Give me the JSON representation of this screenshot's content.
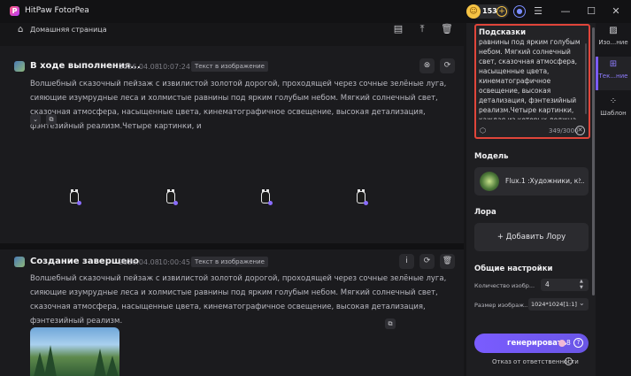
{
  "app": {
    "title": "HitPaw FotorPea",
    "logo_letter": "P",
    "credits": "153",
    "credits_plus": "+"
  },
  "window_controls": {
    "minimize": "—",
    "maximize": "☐",
    "close": "✕",
    "menu": "☰"
  },
  "nav": {
    "home_label": "Домашняя страница"
  },
  "cards": [
    {
      "title": "В ходе выполнения...",
      "date": "2026.04.08",
      "time": "10:07:24",
      "tag": "Текст в изображение",
      "text": "Волшебный сказочный пейзаж с извилистой золотой дорогой, проходящей через сочные зелёные луга, сияющие изумрудные леса и холмистые равнины под ярким голубым небом. Мягкий солнечный свет, сказочная атмосфера, насыщенные цвета, кинематографичное освещение, высокая детализация, фэнтезийный реализм.Четыре картинки, и"
    },
    {
      "title": "Создание завершено",
      "date": "2026.04.08",
      "time": "10:00:45",
      "tag": "Текст в изображение",
      "text": "Волшебный сказочный пейзаж с извилистой золотой дорогой, проходящей через сочные зелёные луга, сияющие изумрудные леса и холмистые равнины под ярким голубым небом. Мягкий солнечный свет, сказочная атмосфера, насыщенные цвета, кинематографичное освещение, высокая детализация, фэнтезийный реализм."
    }
  ],
  "panel": {
    "prompt_label": "Подсказки",
    "prompt_text": "равнины под ярким голубым небом. Мягкий солнечный свет, сказочная атмосфера, насыщенные цвета, кинематографичное освещение, высокая детализация, фэнтезийный реализм.Четыре картинки, каждая из которых должна быть разной",
    "prompt_count": "349/3000",
    "model_label": "Модель",
    "model_name": "Flux.1 :Художники, к...",
    "lora_label": "Лора",
    "lora_button": "+ Добавить Лору",
    "settings_label": "Общие настройки",
    "count_label": "Количество изобр...",
    "count_value": "4",
    "size_label": "Размер изображ...",
    "size_value": "1024*1024[1:1]",
    "generate_label": "генерировать",
    "generate_cost": "8",
    "disclaimer": "Отказ от ответственности"
  },
  "sidebar": {
    "items": [
      {
        "label": "Изо...ние"
      },
      {
        "label": "Тек...ние"
      },
      {
        "label": "Шаблон"
      }
    ]
  }
}
